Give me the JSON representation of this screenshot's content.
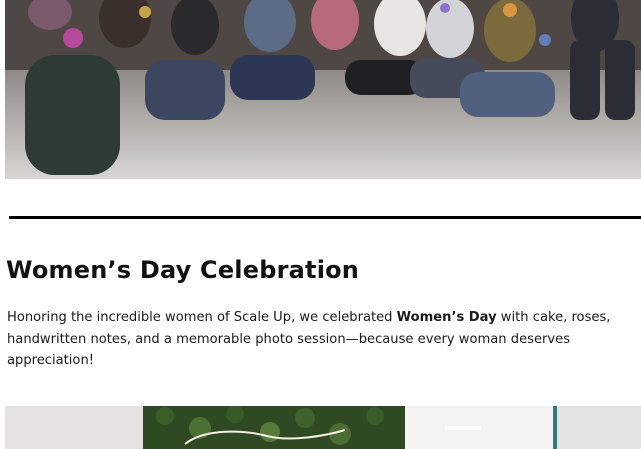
{
  "photos": {
    "top_alt": "Team celebrating Holi",
    "bottom_alt": "Women's Day photo session"
  },
  "section": {
    "title": "Women’s Day Celebration",
    "text_before": "Honoring the incredible women of Scale Up, we celebrated ",
    "text_bold": "Women’s Day",
    "text_after": " with cake, roses, handwritten notes, and a memorable photo session—because every woman deserves appreciation!"
  },
  "colors": {
    "divider": "#000000",
    "text": "#1a1a1a"
  }
}
